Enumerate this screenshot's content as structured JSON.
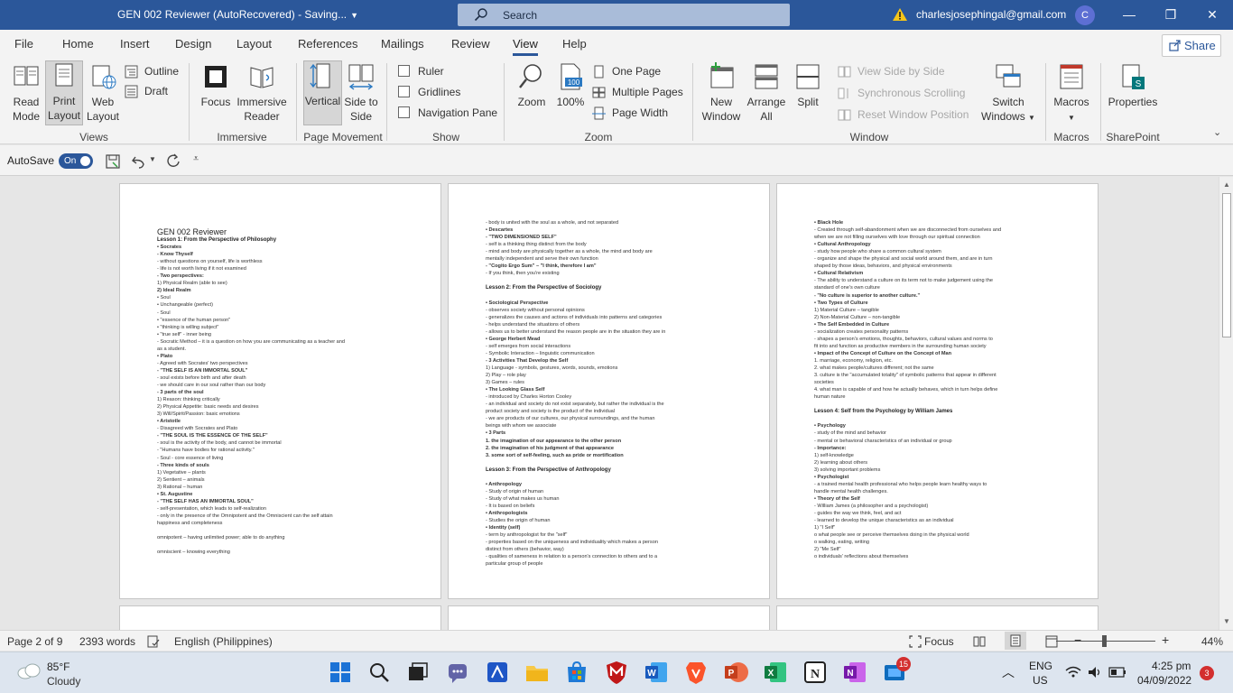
{
  "window": {
    "title": "GEN 002 Reviewer (AutoRecovered)  -  Saving...",
    "search_label": "Search",
    "account_email": "charlesjosephingal@gmail.com",
    "account_initial": "C"
  },
  "menu": {
    "tabs": [
      "File",
      "Home",
      "Insert",
      "Design",
      "Layout",
      "References",
      "Mailings",
      "Review",
      "View",
      "Help"
    ],
    "active_tab": "View",
    "share_label": "Share"
  },
  "ribbon": {
    "views": {
      "read_mode": "Read Mode",
      "print_layout": "Print Layout",
      "web_layout": "Web Layout",
      "outline": "Outline",
      "draft": "Draft",
      "group": "Views"
    },
    "immersive": {
      "focus": "Focus",
      "immersive_reader": "Immersive Reader",
      "group": "Immersive"
    },
    "page_movement": {
      "vertical": "Vertical",
      "side_to_side": "Side to Side",
      "group": "Page Movement"
    },
    "show": {
      "ruler": "Ruler",
      "gridlines": "Gridlines",
      "navigation_pane": "Navigation Pane",
      "group": "Show"
    },
    "zoom": {
      "zoom": "Zoom",
      "hundred": "100%",
      "one_page": "One Page",
      "multiple_pages": "Multiple Pages",
      "page_width": "Page Width",
      "group": "Zoom"
    },
    "window": {
      "new_window": "New Window",
      "arrange_all": "Arrange All",
      "split": "Split",
      "view_side_by_side": "View Side by Side",
      "synchronous_scrolling": "Synchronous Scrolling",
      "reset_window_position": "Reset Window Position",
      "switch_windows": "Switch Windows",
      "group": "Window"
    },
    "macros": {
      "macros": "Macros",
      "group": "Macros"
    },
    "sharepoint": {
      "properties": "Properties",
      "group": "SharePoint"
    }
  },
  "qat": {
    "autosave_label": "AutoSave",
    "toggle_label": "On"
  },
  "document": {
    "page1": [
      {
        "t": "GEN 002 Reviewer",
        "s": "h1"
      },
      {
        "t": "Lesson 1: From the Perspective of Philosophy",
        "s": "h2"
      },
      {
        "t": "•   Socrates",
        "s": "b"
      },
      {
        "t": "        -   Know Thyself",
        "s": "b"
      },
      {
        "t": "        -   without questions on yourself, life is worthless",
        "s": ""
      },
      {
        "t": "        -   life is not worth living if it not examined",
        "s": ""
      },
      {
        "t": "        -   Two perspectives:",
        "s": "b"
      },
      {
        "t": "            1)  Physical Realm (able to see)",
        "s": ""
      },
      {
        "t": "            2)  Ideal Realm",
        "s": "b"
      },
      {
        "t": "                    •  Soul",
        "s": ""
      },
      {
        "t": "                    •  Unchangeable (perfect)",
        "s": ""
      },
      {
        "t": "        -   Soul",
        "s": ""
      },
      {
        "t": "                •  \"essence of the human person\"",
        "s": ""
      },
      {
        "t": "                •  \"thinking is willing subject\"",
        "s": ""
      },
      {
        "t": "                •  \"true self\" - inner being",
        "s": ""
      },
      {
        "t": "        -   Socratic Method – it is a question on how you are communicating as a teacher and",
        "s": ""
      },
      {
        "t": "            as a student.",
        "s": ""
      },
      {
        "t": "•   Plato",
        "s": "b"
      },
      {
        "t": "        -   Agreed with Socrates' two perspectives",
        "s": ""
      },
      {
        "t": "        -   \"THE SELF IS AN IMMORTAL SOUL\"",
        "s": "b"
      },
      {
        "t": "        -   soul exists before birth and after death",
        "s": ""
      },
      {
        "t": "        -   we should care in our soul rather than our body",
        "s": ""
      },
      {
        "t": "        -   3 parts of the soul",
        "s": "b"
      },
      {
        "t": "            1)  Reason: thinking critically",
        "s": ""
      },
      {
        "t": "            2)  Physical Appetite: basic needs and desires",
        "s": ""
      },
      {
        "t": "            3)  Will/Spirit/Passion: basic emotions",
        "s": ""
      },
      {
        "t": "•   Aristotle",
        "s": "b"
      },
      {
        "t": "        -   Disagreed with Socrates and Plato",
        "s": ""
      },
      {
        "t": "        -   \"THE SOUL IS THE ESSENCE OF THE SELF\"",
        "s": "b"
      },
      {
        "t": "        -   soul is the activity of the body, and cannot be immortal",
        "s": ""
      },
      {
        "t": "        -   \"Humans have bodies for rational activity.\"",
        "s": ""
      },
      {
        "t": "        -   Soul - core essence of living",
        "s": ""
      },
      {
        "t": "        -   Three kinds of souls",
        "s": "b"
      },
      {
        "t": "            1)  Vegetative – plants",
        "s": ""
      },
      {
        "t": "            2)  Sentient – animals",
        "s": ""
      },
      {
        "t": "            3)  Rational – human",
        "s": ""
      },
      {
        "t": "•   St. Augustine",
        "s": "b"
      },
      {
        "t": "        -   \"THE SELF HAS AN IMMORTAL SOUL\"",
        "s": "b"
      },
      {
        "t": "        -   self-presentation, which leads to self-realization",
        "s": ""
      },
      {
        "t": "        -   only in the presence of the Omnipotent and the Omniscient can the self attain",
        "s": ""
      },
      {
        "t": "            happiness and completeness",
        "s": ""
      },
      {
        "t": "",
        "s": ""
      },
      {
        "t": "        omnipotent – having unlimited power; able to do anything",
        "s": ""
      },
      {
        "t": "",
        "s": ""
      },
      {
        "t": "        omniscient – knowing everything",
        "s": ""
      }
    ],
    "page2": [
      {
        "t": "        -   body is united with the soul as a whole, and not separated",
        "s": ""
      },
      {
        "t": "    •   Descartes",
        "s": "b"
      },
      {
        "t": "        -   \"TWO DIMENSIONED SELF\"",
        "s": "b"
      },
      {
        "t": "        -   self is a thinking thing distinct from the body",
        "s": ""
      },
      {
        "t": "        -   mind and body are physically together as a whole, the mind and body are",
        "s": ""
      },
      {
        "t": "            mentally independent and serve their own function",
        "s": ""
      },
      {
        "t": "        -   \"Cogito Ergo Sum\" – \"I think, therefore I am\"",
        "s": "b"
      },
      {
        "t": "        -   If you think, then you're existing",
        "s": ""
      },
      {
        "t": "",
        "s": ""
      },
      {
        "t": "Lesson 2: From the Perspective of Sociology",
        "s": "h2"
      },
      {
        "t": "",
        "s": ""
      },
      {
        "t": "    •   Sociological Perspective",
        "s": "b"
      },
      {
        "t": "        -   observes society without personal opinions",
        "s": ""
      },
      {
        "t": "        -   generalizes the causes and actions of individuals into patterns and categories",
        "s": ""
      },
      {
        "t": "        -   helps understand the situations of others",
        "s": ""
      },
      {
        "t": "        -   allows us to better understand the reason people are in the situation they are in",
        "s": ""
      },
      {
        "t": "    •   George Herbert Mead",
        "s": "b"
      },
      {
        "t": "        -   self emerges from social interactions",
        "s": ""
      },
      {
        "t": "        -   Symbolic Interaction – linguistic communication",
        "s": ""
      },
      {
        "t": "        -   3 Activities That Develop the Self",
        "s": "b"
      },
      {
        "t": "            1)  Language - symbols, gestures, words, sounds, emotions",
        "s": ""
      },
      {
        "t": "            2)  Play – role play",
        "s": ""
      },
      {
        "t": "            3)  Games – rules",
        "s": ""
      },
      {
        "t": "    •   The Looking Glass Self",
        "s": "b"
      },
      {
        "t": "        -   introduced by Charles Horton Cooley",
        "s": ""
      },
      {
        "t": "        -   an individual and society do not exist separately, but rather the individual is the",
        "s": ""
      },
      {
        "t": "            product society and society is the product of the individual",
        "s": ""
      },
      {
        "t": "        -   we are products of our cultures, our physical surroundings, and the human",
        "s": ""
      },
      {
        "t": "            beings with whom we associate",
        "s": ""
      },
      {
        "t": "    •   3 Parts",
        "s": "b"
      },
      {
        "t": "    1.  the imagination of our appearance to the other person",
        "s": "b"
      },
      {
        "t": "    2.  the imagination of his judgment of that appearance",
        "s": "b"
      },
      {
        "t": "    3.  some sort of self-feeling, such as pride or mortification",
        "s": "b"
      },
      {
        "t": "",
        "s": ""
      },
      {
        "t": "Lesson 3: From the Perspective of Anthropology",
        "s": "h2"
      },
      {
        "t": "",
        "s": ""
      },
      {
        "t": "    •   Anthropology",
        "s": "b"
      },
      {
        "t": "        -   Study of origin of human",
        "s": ""
      },
      {
        "t": "        -   Study of what makes us human",
        "s": ""
      },
      {
        "t": "        -   It is based on beliefs",
        "s": ""
      },
      {
        "t": "    •   Anthropologists",
        "s": "b"
      },
      {
        "t": "        -   Studies the origin of human",
        "s": ""
      },
      {
        "t": "    •   Identity (self)",
        "s": "b"
      },
      {
        "t": "        -   term by anthropologist for the \"self\"",
        "s": ""
      },
      {
        "t": "        -   properties based on the uniqueness and individuality which makes a person",
        "s": ""
      },
      {
        "t": "            distinct from others (behavior, way)",
        "s": ""
      },
      {
        "t": "        -   qualities of sameness in relation to a person's connection to others and to a",
        "s": ""
      },
      {
        "t": "            particular group of people",
        "s": ""
      }
    ],
    "page3": [
      {
        "t": "    •   Black Hole",
        "s": "b"
      },
      {
        "t": "        -   Created through self-abandonment when we are disconnected from ourselves and",
        "s": ""
      },
      {
        "t": "            when we are not filling ourselves with love through our spiritual connection",
        "s": ""
      },
      {
        "t": "    •   Cultural Anthropology",
        "s": "b"
      },
      {
        "t": "        -   study how people who share a common cultural system",
        "s": ""
      },
      {
        "t": "        -   organize and shape the physical and social world around them, and are in turn",
        "s": ""
      },
      {
        "t": "            shaped by those ideas, behaviors, and physical environments",
        "s": ""
      },
      {
        "t": "    •   Cultural Relativism",
        "s": "b"
      },
      {
        "t": "        -   The ability to understand a culture on its term not to make judgement using the",
        "s": ""
      },
      {
        "t": "            standard of one's own culture",
        "s": ""
      },
      {
        "t": "        -   \"No culture is superior to another culture.\"",
        "s": "b"
      },
      {
        "t": "    •   Two Types of Culture",
        "s": "b"
      },
      {
        "t": "    1)  Material Culture – tangible",
        "s": ""
      },
      {
        "t": "    2)  Non-Material Culture – non-tangible",
        "s": ""
      },
      {
        "t": "    •   The Self Embedded in Culture",
        "s": "b"
      },
      {
        "t": "        -   socialization creates personality patterns",
        "s": ""
      },
      {
        "t": "        -   shapes a person's emotions, thoughts, behaviors, cultural values and norms to",
        "s": ""
      },
      {
        "t": "            fit into and function as productive members in the surrounding human society",
        "s": ""
      },
      {
        "t": "    •   Impact of the Concept of Culture on the Concept of Man",
        "s": "b"
      },
      {
        "t": "        1.  marriage, economy, religion, etc.",
        "s": ""
      },
      {
        "t": "        2.  what makes people/cultures different; not the same",
        "s": ""
      },
      {
        "t": "        3.  culture is the \"accumulated totality\" of symbolic patterns that appear in different",
        "s": ""
      },
      {
        "t": "            societies",
        "s": ""
      },
      {
        "t": "        4.  what man is capable of and how he actually behaves, which in turn helps define",
        "s": ""
      },
      {
        "t": "            human nature",
        "s": ""
      },
      {
        "t": "",
        "s": ""
      },
      {
        "t": "Lesson 4: Self from the Psychology by William James",
        "s": "h2"
      },
      {
        "t": "",
        "s": ""
      },
      {
        "t": "    •   Psychology",
        "s": "b"
      },
      {
        "t": "        -   study of the mind and behavior",
        "s": ""
      },
      {
        "t": "        -   mental or behavioral characteristics of an individual or group",
        "s": ""
      },
      {
        "t": "        -   Importance:",
        "s": "b"
      },
      {
        "t": "            1)  self-knowledge",
        "s": ""
      },
      {
        "t": "            2)  learning about others",
        "s": ""
      },
      {
        "t": "            3)  solving important problems",
        "s": ""
      },
      {
        "t": "    •   Psychologist",
        "s": "b"
      },
      {
        "t": "        -   a trained mental health professional who helps people learn healthy ways to",
        "s": ""
      },
      {
        "t": "            handle mental health challenges.",
        "s": ""
      },
      {
        "t": "    •   Theory of the Self",
        "s": "b"
      },
      {
        "t": "        -   William James (a philosopher and a psychologist)",
        "s": ""
      },
      {
        "t": "        -   guides the way we think, feel, and act",
        "s": ""
      },
      {
        "t": "        -   learned to develop the unique characteristics as an individual",
        "s": ""
      },
      {
        "t": "            1)  \"I Self\"",
        "s": ""
      },
      {
        "t": "                    o   what people see or perceive themselves doing in the physical world",
        "s": ""
      },
      {
        "t": "                    o   walking, eating, writing",
        "s": ""
      },
      {
        "t": "            2)  \"Me Self\"",
        "s": ""
      },
      {
        "t": "                    o   individuals' reflections about themselves",
        "s": ""
      }
    ]
  },
  "statusbar": {
    "page": "Page 2 of 9",
    "words": "2393 words",
    "language": "English (Philippines)",
    "focus": "Focus",
    "zoom_minus": "−",
    "zoom_plus": "+",
    "zoom_pct": "44%",
    "zoom_level": 0.44
  },
  "taskbar": {
    "temp": "85°F",
    "condition": "Cloudy",
    "lang1": "ENG",
    "lang2": "US",
    "time": "4:25 pm",
    "date": "04/09/2022",
    "notif_count": "3",
    "badge_count": "15"
  },
  "colors": {
    "accent": "#2b579a",
    "ribbon_bg": "#f3f3f3",
    "doc_bg": "#e6e6e6"
  }
}
